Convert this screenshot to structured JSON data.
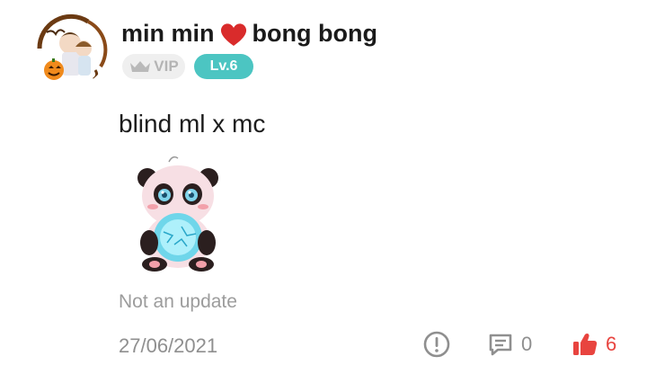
{
  "post": {
    "author": {
      "name_part1": "min min",
      "name_part2": "bong bong",
      "vip_label": "VIP",
      "level_label": "Lv.6"
    },
    "text": "blind ml x mc",
    "note": "Not an update",
    "date": "27/06/2021",
    "actions": {
      "comments": "0",
      "likes": "6"
    }
  },
  "colors": {
    "level_badge": "#4cc5c2",
    "like": "#e8443f",
    "heart": "#d92b2b"
  }
}
